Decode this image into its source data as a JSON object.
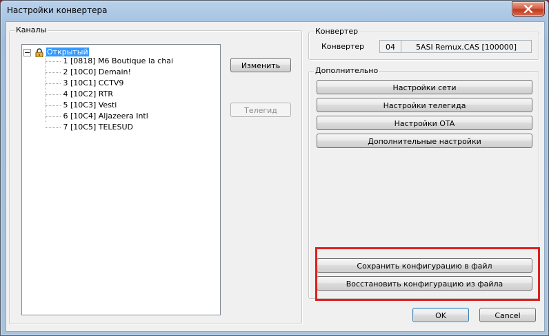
{
  "window": {
    "title": "Настройки конвертера"
  },
  "channels": {
    "label": "Каналы",
    "root_label": "Открытый",
    "items": [
      "1 [0818] M6 Boutique la chai",
      "2 [10C0] Demain!",
      "3 [10C1] CCTV9",
      "4 [10C2] RTR",
      "5 [10C3] Vesti",
      "6 [10C4] Aljazeera Intl",
      "7 [10C5] TELESUD"
    ],
    "edit_button": "Изменить",
    "epg_button": "Телегид"
  },
  "converter": {
    "label": "Конвертер",
    "field_label": "Конвертер",
    "id": "04",
    "name": "5ASI Remux.CAS [100000]"
  },
  "additional": {
    "label": "Дополнительно",
    "buttons": [
      "Настройки сети",
      "Настройки телегида",
      "Настройки OTA",
      "Дополнительные настройки"
    ],
    "save_config": "Сохранить конфигурацию в файл",
    "restore_config": "Восстановить конфигурацию из файла"
  },
  "footer": {
    "ok": "OK",
    "cancel": "Cancel"
  },
  "colors": {
    "highlight": "#e0201c",
    "tree_selection": "#3399ff"
  }
}
